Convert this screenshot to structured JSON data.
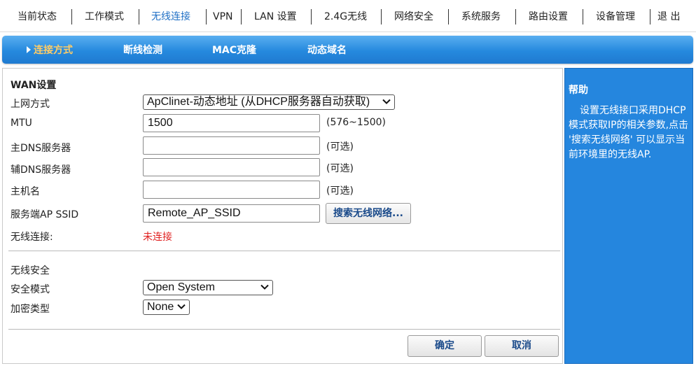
{
  "nav": {
    "items": [
      "当前状态",
      "工作模式",
      "无线连接",
      "VPN",
      "LAN 设置",
      "2.4G无线",
      "网络安全",
      "系统服务",
      "路由设置",
      "设备管理",
      "退 出"
    ],
    "active": "无线连接"
  },
  "subnav": {
    "tabs": [
      "连接方式",
      "断线检测",
      "MAC克隆",
      "动态域名"
    ],
    "active": "连接方式"
  },
  "wan": {
    "section_title": "WAN设置",
    "mode_label": "上网方式",
    "mode_value": "ApClinet-动态地址 (从DHCP服务器自动获取)",
    "mtu_label": "MTU",
    "mtu_value": "1500",
    "mtu_hint": "(576~1500)",
    "dns1_label": "主DNS服务器",
    "dns1_value": "",
    "dns1_hint": "(可选)",
    "dns2_label": "辅DNS服务器",
    "dns2_value": "",
    "dns2_hint": "(可选)",
    "hostname_label": "主机名",
    "hostname_value": "",
    "hostname_hint": "(可选)",
    "ssid_label": "服务端AP SSID",
    "ssid_value": "Remote_AP_SSID",
    "scan_button": "搜索无线网络...",
    "conn_label": "无线连接:",
    "conn_value": "未连接"
  },
  "security": {
    "section_title": "无线安全",
    "mode_label": "安全模式",
    "mode_value": "Open System",
    "enc_label": "加密类型",
    "enc_value": "None"
  },
  "actions": {
    "ok": "确定",
    "cancel": "取消"
  },
  "help": {
    "title": "帮助",
    "text": "设置无线接口采用DHCP模式获取IP的相关参数,点击 '搜索无线网络' 可以显示当前环境里的无线AP."
  },
  "colors": {
    "accent_blue": "#2586de",
    "active_nav": "#1f6fc5",
    "active_tab": "#ffcc66",
    "error_red": "#e02020"
  }
}
